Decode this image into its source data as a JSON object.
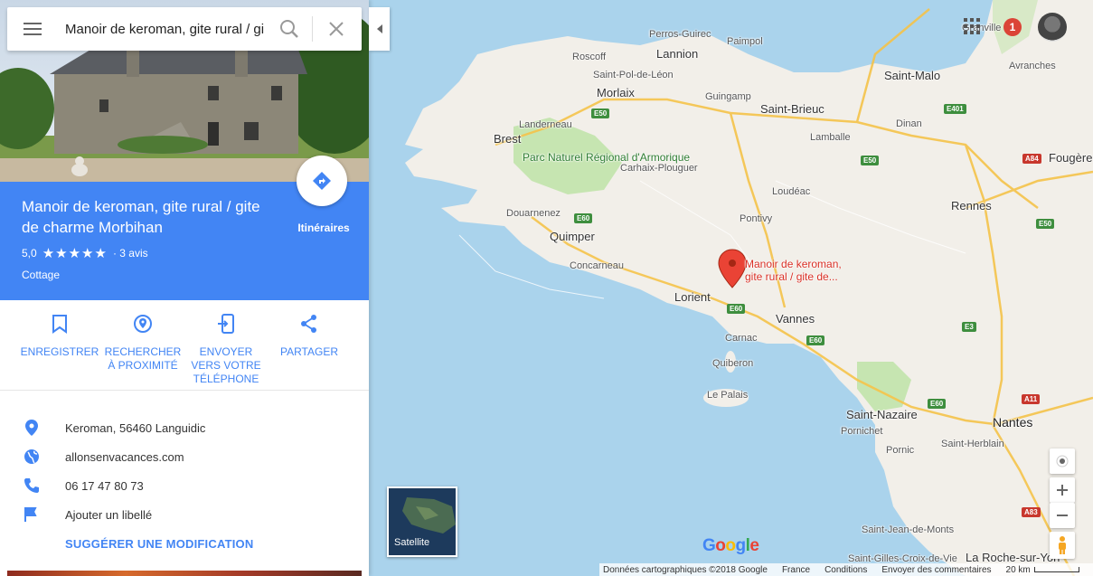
{
  "search": {
    "value": "Manoir de keroman, gite rural / gite de charme Morbihan"
  },
  "place": {
    "name": "Manoir de keroman, gite rural / gite de charme Morbihan",
    "rating": "5,0",
    "stars": "★★★★★",
    "reviews": "· 3 avis",
    "category": "Cottage",
    "directions_label": "Itinéraires"
  },
  "actions": [
    {
      "label": "ENREGISTRER",
      "icon": "bookmark-icon"
    },
    {
      "label": "RECHERCHER À PROXIMITÉ",
      "icon": "nearby-icon"
    },
    {
      "label": "ENVOYER VERS VOTRE TÉLÉPHONE",
      "icon": "send-to-phone-icon"
    },
    {
      "label": "PARTAGER",
      "icon": "share-icon"
    }
  ],
  "info": {
    "address": "Keroman, 56460 Languidic",
    "website": "allonsenvacances.com",
    "phone": "06 17 47 80 73",
    "label": "Ajouter un libellé",
    "suggest": "SUGGÉRER UNE MODIFICATION"
  },
  "header": {
    "notifications": "1"
  },
  "map": {
    "places": [
      "Perros-Guirec",
      "Paimpol",
      "Roscoff",
      "Lannion",
      "Saint-Pol-de-Léon",
      "Morlaix",
      "Guingamp",
      "Saint-Malo",
      "Avranches",
      "Saint-Brieuc",
      "Landerneau",
      "Brest",
      "Dinan",
      "Lamballe",
      "Carhaix-Plouguer",
      "Fougère",
      "Loudéac",
      "Douarnenez",
      "Pontivy",
      "Rennes",
      "Quimper",
      "Concarneau",
      "Lorient",
      "Vannes",
      "Carnac",
      "Quiberon",
      "Le Palais",
      "Saint-Nazaire",
      "Pornichet",
      "Nantes",
      "Saint-Herblain",
      "Pornic",
      "Saint-Jean-de-Monts",
      "Saint-Gilles-Croix-de-Vie",
      "La Roche-sur-Yon",
      "Granville"
    ],
    "park": "Parc Naturel Régional d'Armorique",
    "roads": [
      "E50",
      "E401",
      "E50",
      "A84",
      "E60",
      "E50",
      "E60",
      "E60",
      "E3",
      "E60",
      "A11",
      "A83"
    ],
    "pin_label_1": "Manoir de keroman,",
    "pin_label_2": "gite rural / gite de...",
    "satellite_label": "Satellite",
    "google": "Google"
  },
  "footer": {
    "data": "Données cartographiques ©2018 Google",
    "country": "France",
    "terms": "Conditions",
    "feedback": "Envoyer des commentaires",
    "scale": "20 km"
  },
  "colors": {
    "accent": "#4285f4",
    "pin": "#d93025",
    "water": "#aad3ec",
    "land": "#f2efe9"
  }
}
